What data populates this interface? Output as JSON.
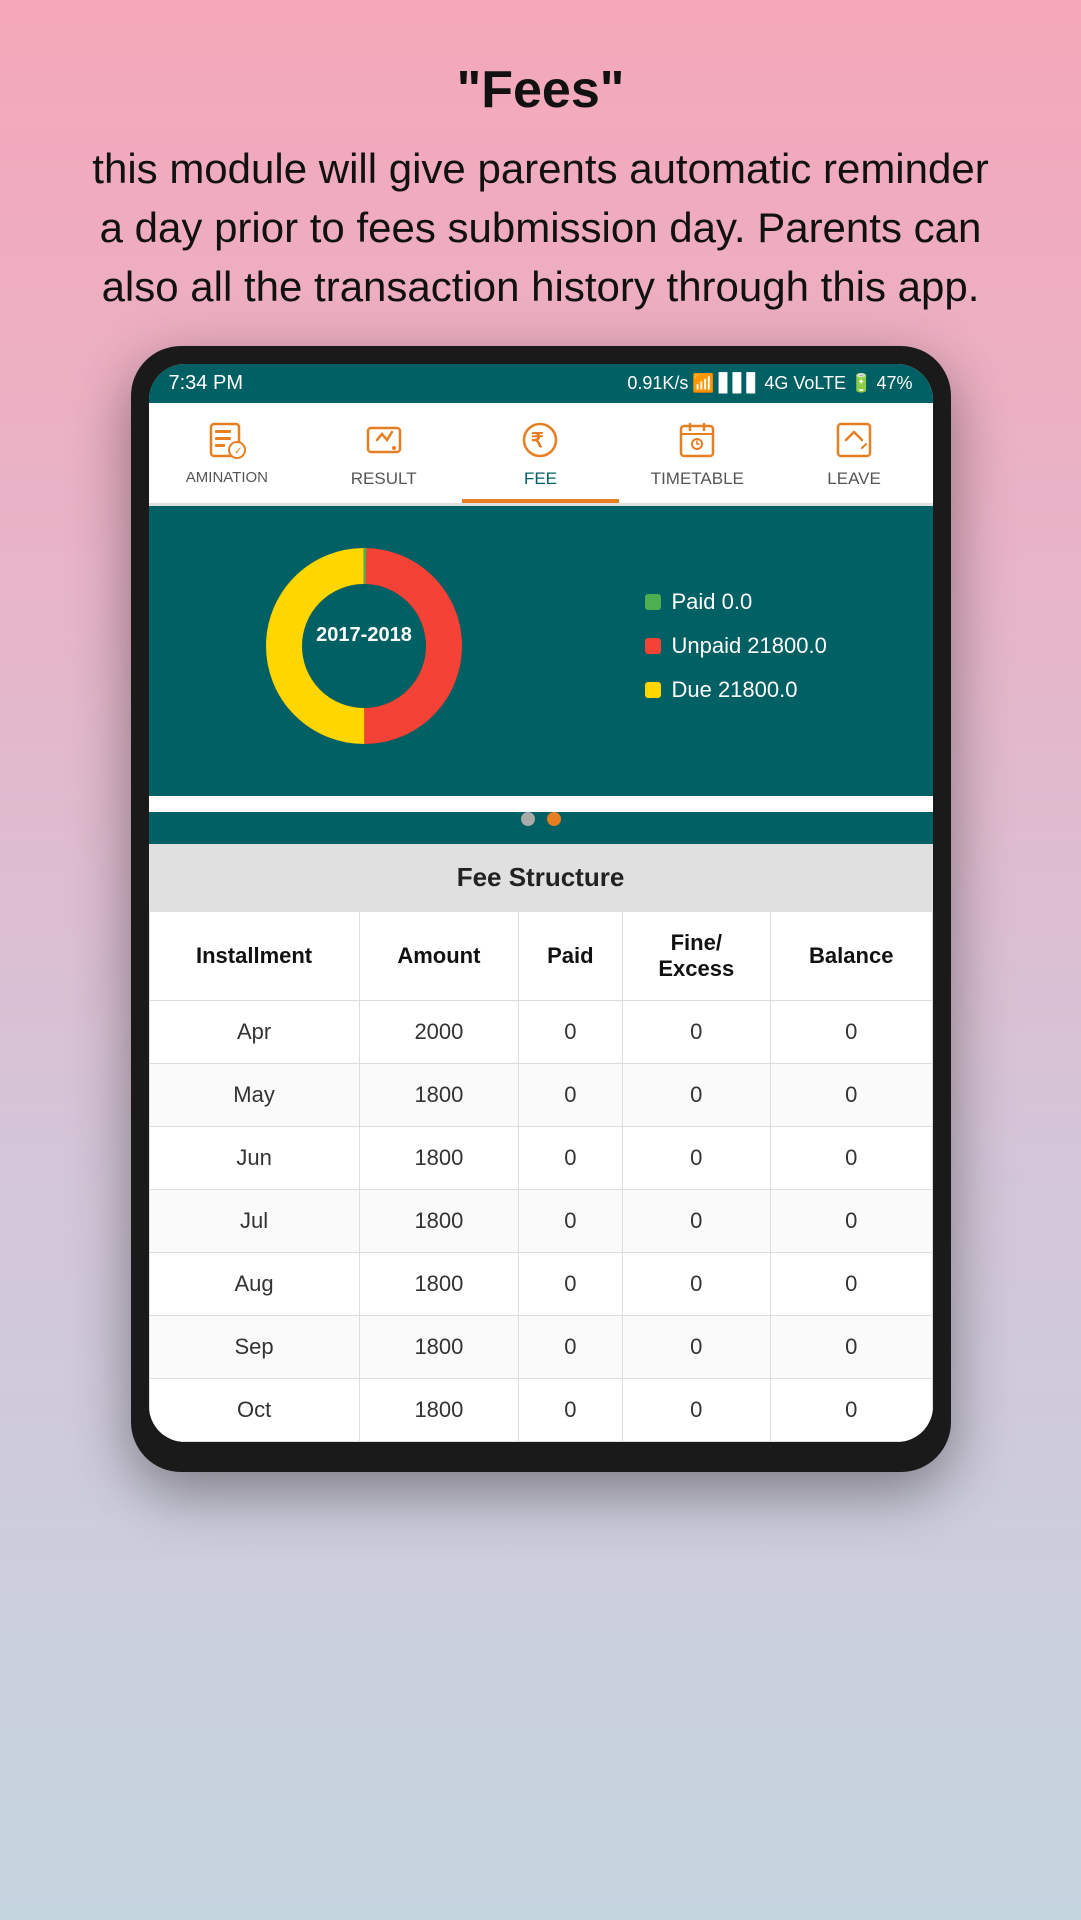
{
  "header": {
    "title": "\"Fees\"",
    "description": "this module will give parents automatic reminder a day prior to fees submission day. Parents can also all the transaction history through this app."
  },
  "status_bar": {
    "time": "7:34 PM",
    "data_speed": "0.91K/s",
    "network": "4G VoLTE",
    "battery": "47%"
  },
  "nav_tabs": [
    {
      "id": "examination",
      "label": "AMINATION",
      "active": false
    },
    {
      "id": "result",
      "label": "RESULT",
      "active": false
    },
    {
      "id": "fee",
      "label": "FEE",
      "active": true
    },
    {
      "id": "timetable",
      "label": "TIMETABLE",
      "active": false
    },
    {
      "id": "leave",
      "label": "LEAVE",
      "active": false
    }
  ],
  "chart": {
    "year": "2017-2018",
    "legend": [
      {
        "label": "Paid 0.0",
        "color_class": "dot-paid"
      },
      {
        "label": "Unpaid 21800.0",
        "color_class": "dot-unpaid"
      },
      {
        "label": "Due 21800.0",
        "color_class": "dot-due"
      }
    ],
    "carousel_dots": [
      {
        "active": false
      },
      {
        "active": true
      }
    ]
  },
  "fee_structure": {
    "title": "Fee Structure",
    "columns": [
      "Installment",
      "Amount",
      "Paid",
      "Fine/\nExcess",
      "Balance"
    ],
    "rows": [
      {
        "month": "Apr",
        "amount": "2000",
        "paid": "0",
        "fine": "0",
        "balance": "0"
      },
      {
        "month": "May",
        "amount": "1800",
        "paid": "0",
        "fine": "0",
        "balance": "0"
      },
      {
        "month": "Jun",
        "amount": "1800",
        "paid": "0",
        "fine": "0",
        "balance": "0"
      },
      {
        "month": "Jul",
        "amount": "1800",
        "paid": "0",
        "fine": "0",
        "balance": "0"
      },
      {
        "month": "Aug",
        "amount": "1800",
        "paid": "0",
        "fine": "0",
        "balance": "0"
      },
      {
        "month": "Sep",
        "amount": "1800",
        "paid": "0",
        "fine": "0",
        "balance": "0"
      },
      {
        "month": "Oct",
        "amount": "1800",
        "paid": "0",
        "fine": "0",
        "balance": "0"
      }
    ]
  }
}
